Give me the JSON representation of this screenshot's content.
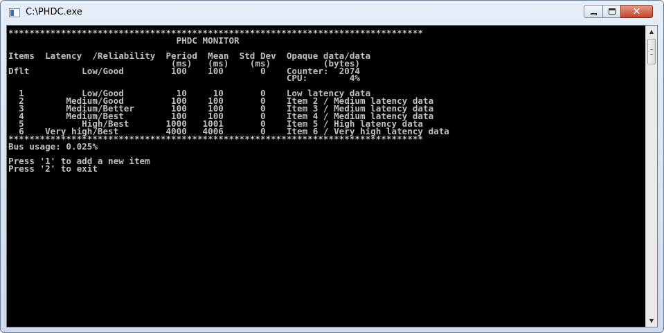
{
  "window": {
    "title": "C:\\PHDC.exe"
  },
  "console": {
    "lines": [
      "*******************************************************************************",
      "                                PHDC MONITOR",
      "",
      "Items  Latency  /Reliability  Period  Mean  Std Dev  Opaque data/data",
      "                               (ms)   (ms)    (ms)          (bytes)",
      "Dflt          Low/Good         100    100       0    Counter:  2074",
      "                                                     CPU:        4%",
      "",
      "  1           Low/Good          10     10       0    Low latency data",
      "  2        Medium/Good         100    100       0    Item 2 / Medium latency data",
      "  3        Medium/Better       100    100       0    Item 3 / Medium latency data",
      "  4        Medium/Best         100    100       0    Item 4 / Medium latency data",
      "  5           High/Best       1000   1001       0    Item 5 / High latency data",
      "  6    Very high/Best         4000   4006       0    Item 6 / Very high latency data",
      "*******************************************************************************",
      "Bus usage: 0.025%",
      "",
      "Press '1' to add a new item",
      "Press '2' to exit"
    ]
  }
}
